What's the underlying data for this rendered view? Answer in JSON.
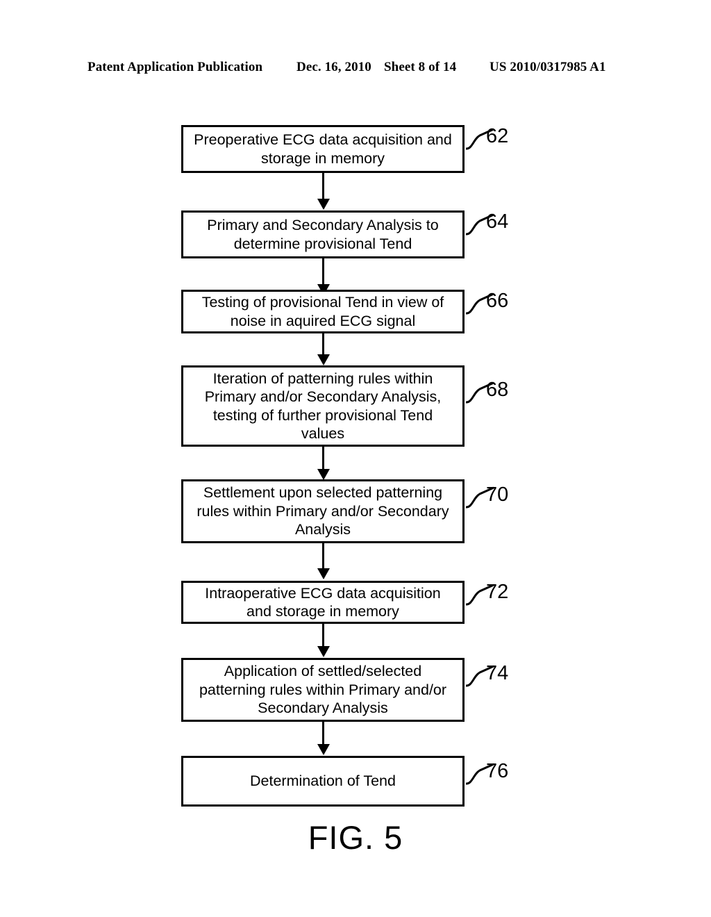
{
  "header": {
    "publication": "Patent Application Publication",
    "date": "Dec. 16, 2010",
    "sheet": "Sheet 8 of 14",
    "patent_number": "US 2010/0317985 A1"
  },
  "figure": {
    "caption": "FIG. 5",
    "type": "flowchart",
    "orientation": "vertical-top-to-bottom",
    "line_color": "#000000",
    "background_color": "#ffffff"
  },
  "flowchart": {
    "steps": [
      {
        "ref": "62",
        "text": "Preoperative ECG data acquisition and storage in memory",
        "lines": [
          "Preoperative ECG data acquisition and",
          "storage in memory"
        ]
      },
      {
        "ref": "64",
        "text": "Primary and Secondary Analysis to determine provisional Tend",
        "lines": [
          "Primary and Secondary Analysis to",
          "determine provisional Tend"
        ]
      },
      {
        "ref": "66",
        "text": "Testing of provisional Tend in view of noise in aquired ECG signal",
        "lines": [
          "Testing of provisional Tend in view of",
          "noise in aquired ECG signal"
        ]
      },
      {
        "ref": "68",
        "text": "Iteration of patterning rules within Primary and/or Secondary Analysis, testing of further provisional Tend values",
        "lines": [
          "Iteration of patterning rules within",
          "Primary and/or Secondary Analysis,",
          "testing of further provisional Tend",
          "values"
        ]
      },
      {
        "ref": "70",
        "text": "Settlement upon selected patterning rules within Primary and/or Secondary Analysis",
        "lines": [
          "Settlement upon selected patterning",
          "rules within Primary and/or Secondary",
          "Analysis"
        ]
      },
      {
        "ref": "72",
        "text": "Intraoperative ECG data acquisition and storage in memory",
        "lines": [
          "Intraoperative ECG data acquisition",
          "and storage in memory"
        ]
      },
      {
        "ref": "74",
        "text": "Application of settled/selected patterning rules within Primary and/or Secondary Analysis",
        "lines": [
          "Application of settled/selected",
          "patterning rules within Primary and/or",
          "Secondary Analysis"
        ]
      },
      {
        "ref": "76",
        "text": "Determination of Tend",
        "lines": [
          "Determination of Tend"
        ]
      }
    ],
    "connector_count": 7
  }
}
